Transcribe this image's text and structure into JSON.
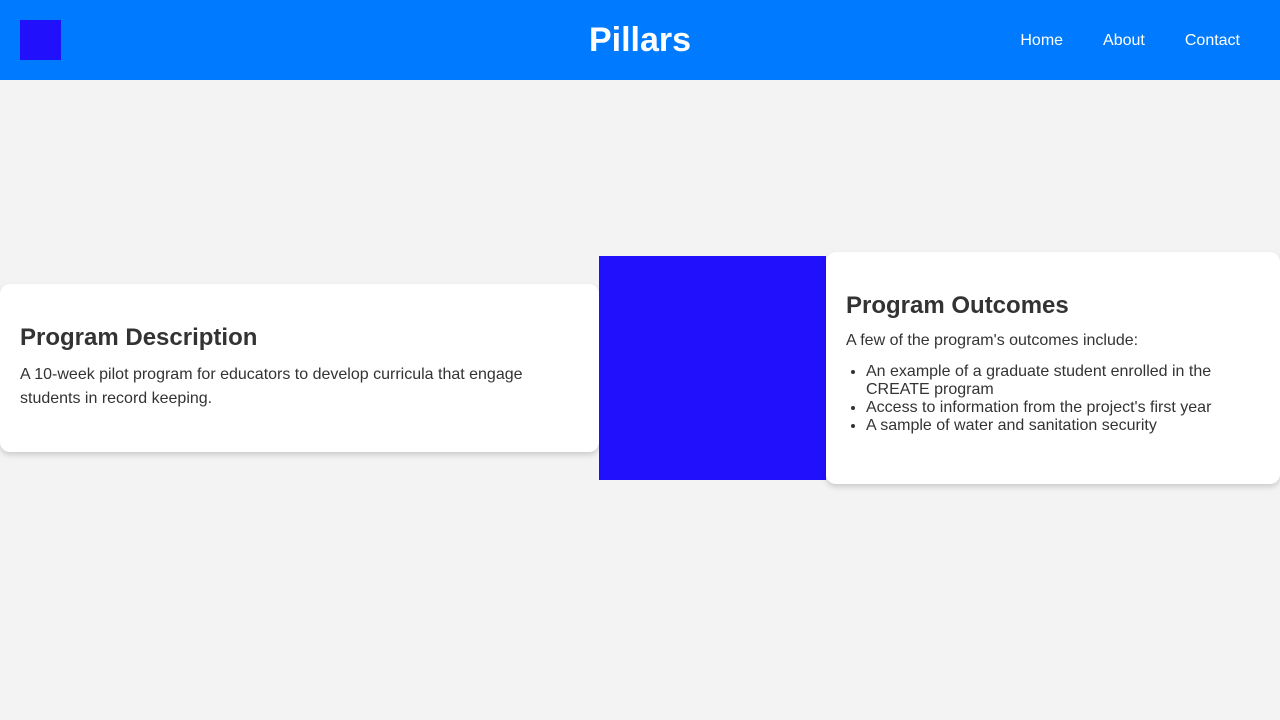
{
  "colors": {
    "header_bg": "#007bff",
    "logo": "#2010fb",
    "image_block": "#2010fb",
    "page_bg": "#f3f3f3",
    "card_bg": "#ffffff",
    "text": "#333333"
  },
  "header": {
    "title": "Pillars",
    "nav": [
      {
        "label": "Home"
      },
      {
        "label": "About"
      },
      {
        "label": "Contact"
      }
    ]
  },
  "description": {
    "heading": "Program Description",
    "text": "A 10-week pilot program for educators to develop curricula that engage students in record keeping."
  },
  "outcomes": {
    "heading": "Program Outcomes",
    "intro": "A few of the program's outcomes include:",
    "items": [
      "An example of a graduate student enrolled in the CREATE program",
      "Access to information from the project's first year",
      "A sample of water and sanitation security"
    ]
  }
}
